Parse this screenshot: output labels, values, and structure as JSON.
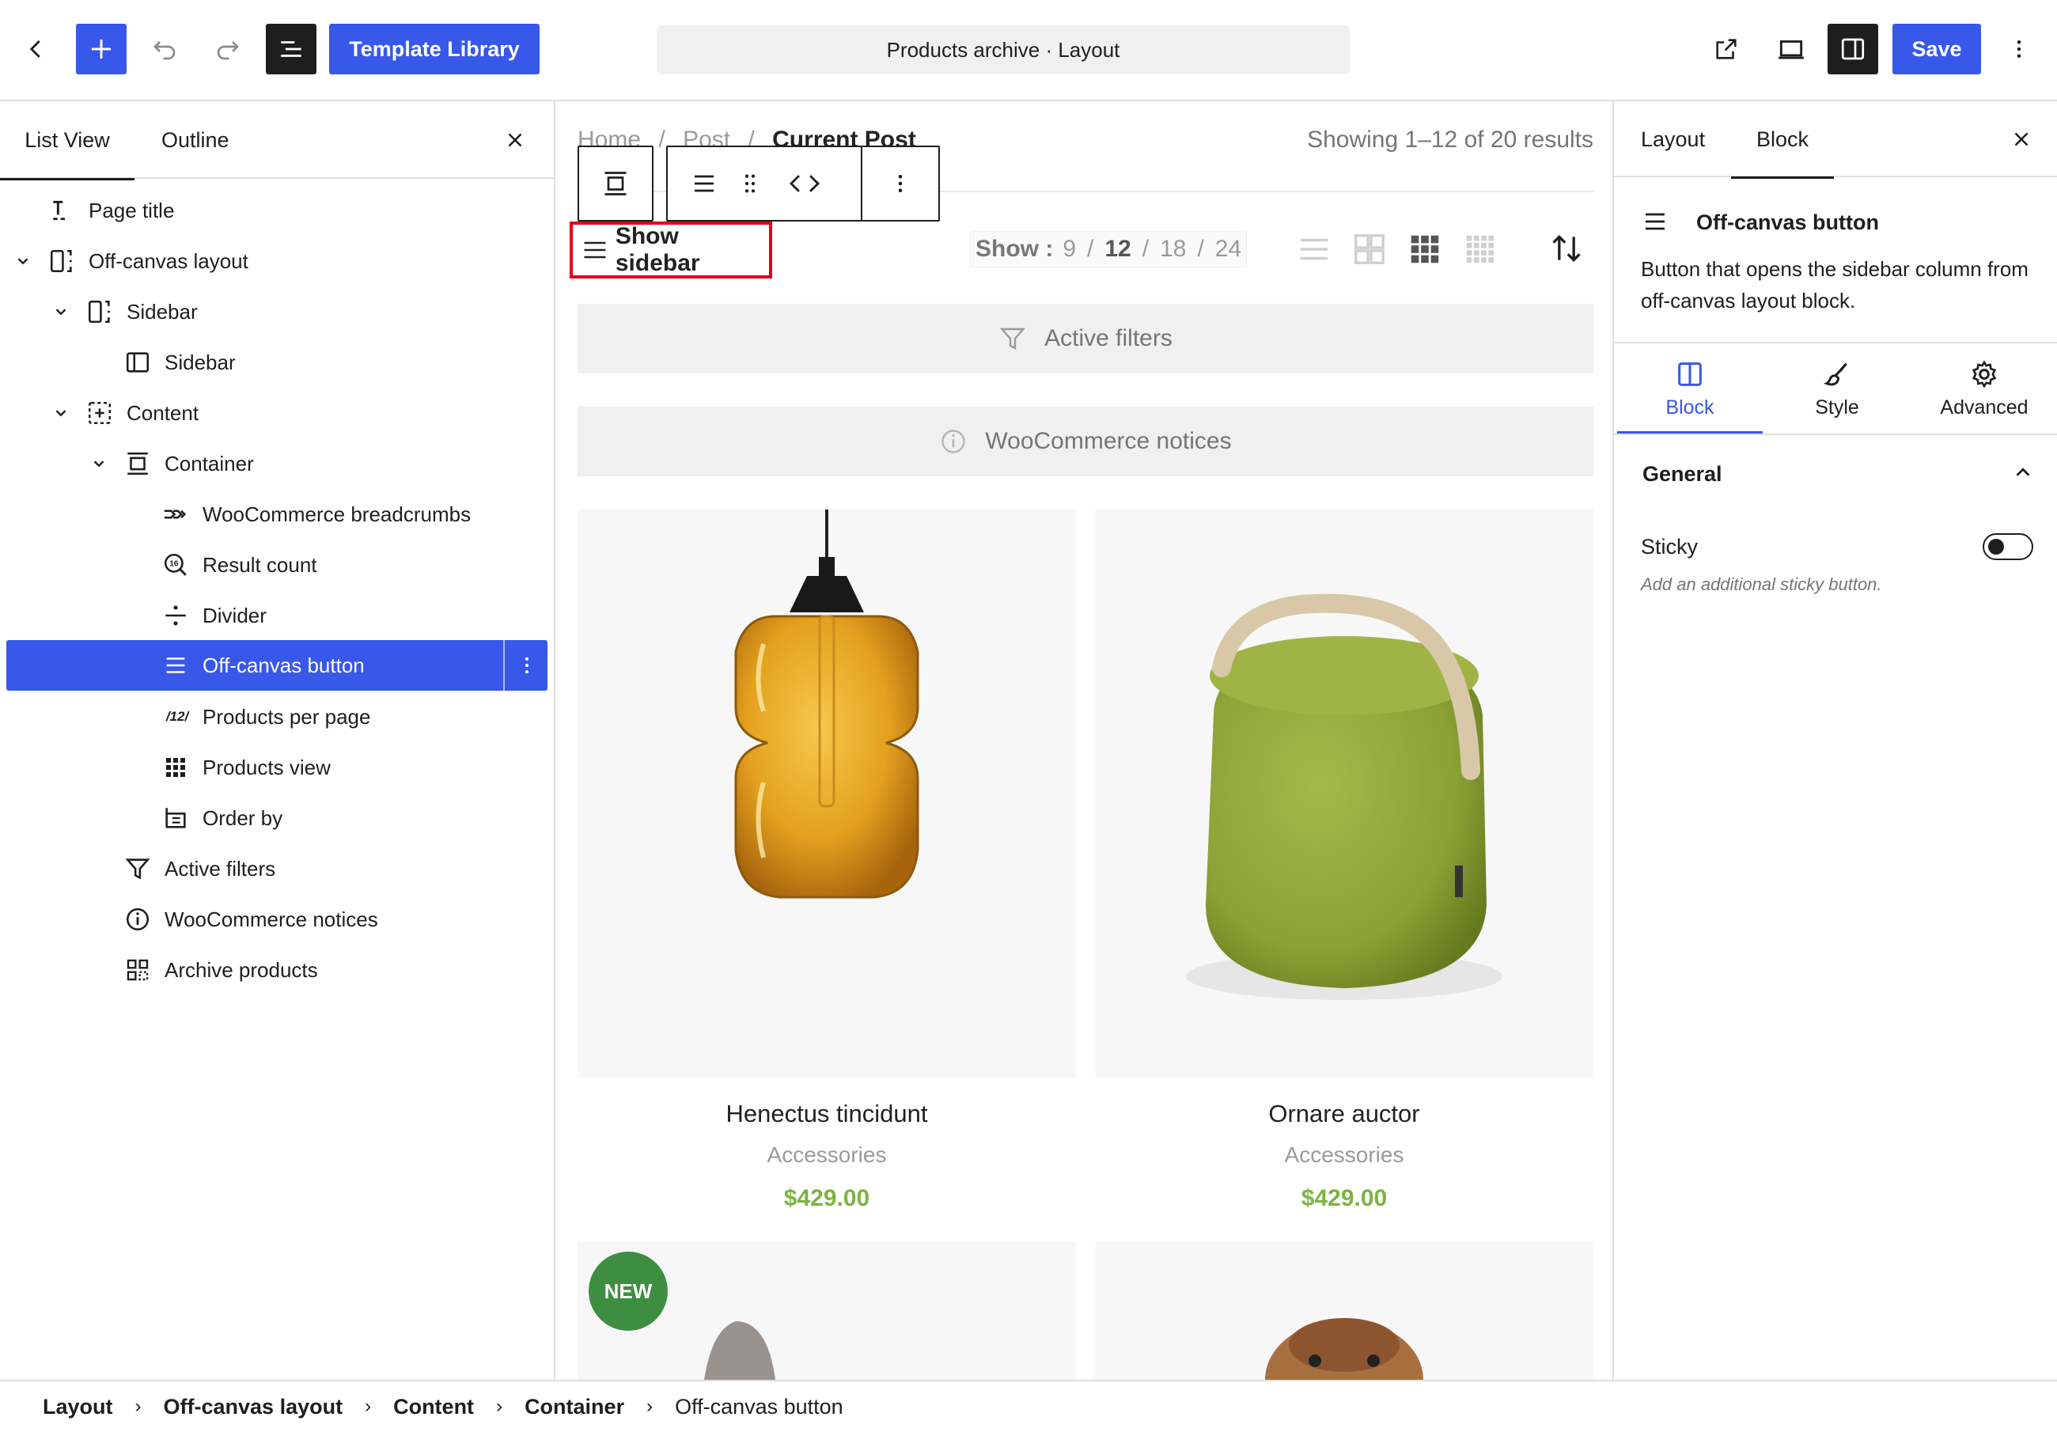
{
  "topbar": {
    "template_library_label": "Template Library",
    "document_title": "Products archive · Layout",
    "save_label": "Save"
  },
  "left_panel": {
    "tabs": [
      "List View",
      "Outline"
    ],
    "active_tab": "List View",
    "tree": [
      {
        "label": "Page title",
        "icon": "page-title-icon"
      },
      {
        "label": "Off-canvas layout",
        "icon": "off-canvas-layout-icon"
      },
      {
        "label": "Sidebar",
        "icon": "sidebar-bracket-icon"
      },
      {
        "label": "Sidebar",
        "icon": "sidebar-panel-icon"
      },
      {
        "label": "Content",
        "icon": "content-plus-icon"
      },
      {
        "label": "Container",
        "icon": "container-icon"
      },
      {
        "label": "WooCommerce breadcrumbs",
        "icon": "breadcrumbs-icon"
      },
      {
        "label": "Result count",
        "icon": "result-count-icon"
      },
      {
        "label": "Divider",
        "icon": "divider-icon"
      },
      {
        "label": "Off-canvas button",
        "icon": "menu-lines-icon",
        "selected": true
      },
      {
        "label": "Products per page",
        "icon": "products-per-page-icon",
        "icon_text": "/12/"
      },
      {
        "label": "Products view",
        "icon": "grid-dots-icon"
      },
      {
        "label": "Order by",
        "icon": "order-by-icon"
      },
      {
        "label": "Active filters",
        "icon": "filter-icon"
      },
      {
        "label": "WooCommerce notices",
        "icon": "info-icon"
      },
      {
        "label": "Archive products",
        "icon": "archive-products-icon"
      }
    ]
  },
  "canvas": {
    "breadcrumb": {
      "home": "Home",
      "post": "Post",
      "current": "Current Post",
      "sep": "/"
    },
    "result_count": "Showing 1–12 of 20 results",
    "show_sidebar_label": "Show sidebar",
    "per_page": {
      "label": "Show :",
      "options": [
        "9",
        "12",
        "18",
        "24"
      ],
      "selected": "12"
    },
    "active_filters_label": "Active filters",
    "notices_label": "WooCommerce notices",
    "products": [
      {
        "name": "Henectus tincidunt",
        "category": "Accessories",
        "price": "$429.00"
      },
      {
        "name": "Ornare auctor",
        "category": "Accessories",
        "price": "$429.00"
      }
    ],
    "new_badge": "NEW"
  },
  "right_panel": {
    "tabs": [
      "Layout",
      "Block"
    ],
    "active_tab": "Block",
    "block_title": "Off-canvas button",
    "block_description": "Button that opens the sidebar column from off-canvas layout block.",
    "sub_tabs": [
      "Block",
      "Style",
      "Advanced"
    ],
    "active_sub_tab": "Block",
    "section_title": "General",
    "sticky_label": "Sticky",
    "sticky_help": "Add an additional sticky button.",
    "sticky_on": false
  },
  "bottom_breadcrumb": [
    "Layout",
    "Off-canvas layout",
    "Content",
    "Container",
    "Off-canvas button"
  ],
  "colors": {
    "accent": "#3858e9",
    "price_green": "#7cb342",
    "new_badge_green": "#3e8e41",
    "highlight_red": "#e0001a"
  }
}
